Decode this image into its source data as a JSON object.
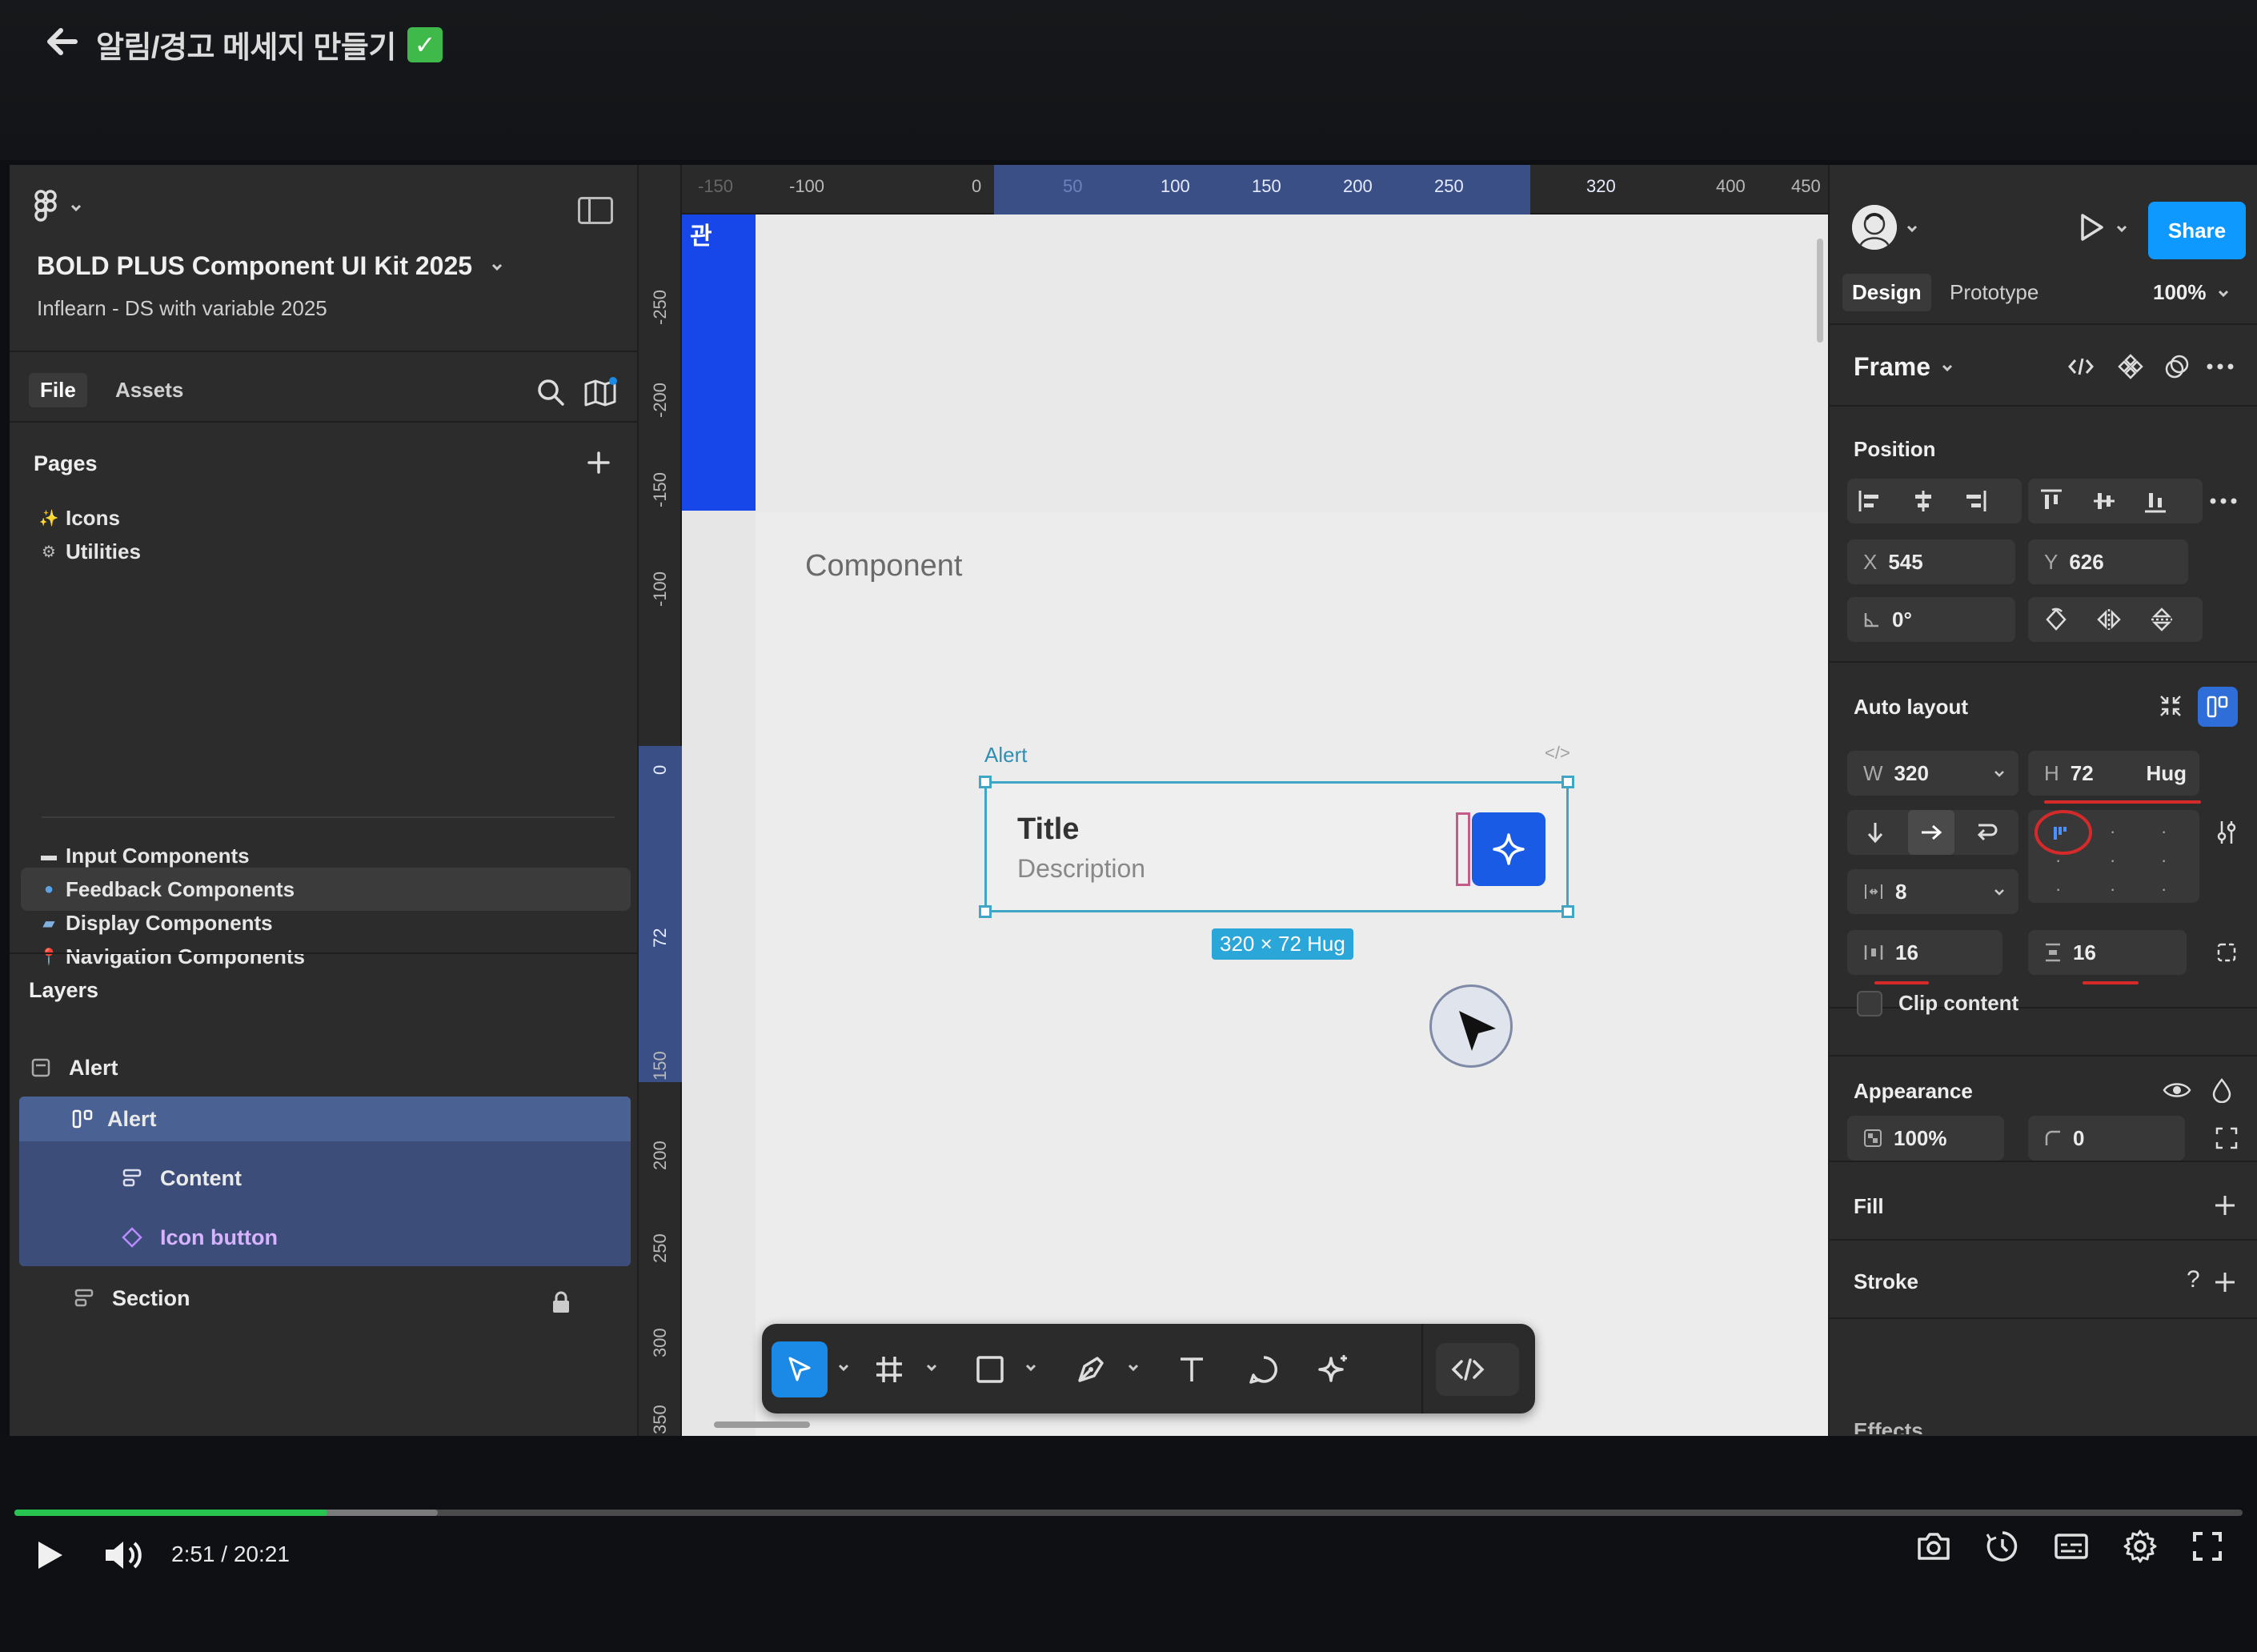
{
  "video": {
    "title": "알림/경고 메세지 만들기",
    "title_badge": "✓",
    "time": "2:51 / 20:21",
    "progress_fraction": 0.1405,
    "buffer_fraction": 0.19
  },
  "left_panel": {
    "file_name": "BOLD PLUS Component UI Kit 2025",
    "file_subtitle": "Inflearn - DS with variable 2025",
    "tabs": {
      "file": "File",
      "assets": "Assets"
    },
    "pages_title": "Pages",
    "pages": [
      {
        "emoji": "✨",
        "label": "Icons"
      },
      {
        "emoji": "⚙",
        "label": "Utilities"
      },
      {
        "emoji": "▬",
        "label": "Input Components"
      },
      {
        "emoji": "●",
        "label": "Feedback Components"
      },
      {
        "emoji": "▰",
        "label": "Display Components"
      },
      {
        "emoji": "📍",
        "label": "Navigation Components"
      }
    ],
    "layers_title": "Layers",
    "layers": [
      {
        "label": "Alert"
      },
      {
        "label": "Alert"
      },
      {
        "label": "Content"
      },
      {
        "label": "Icon button"
      },
      {
        "label": "Section"
      }
    ]
  },
  "rulers": {
    "top": [
      "-150",
      "-100",
      "0",
      "50",
      "100",
      "150",
      "200",
      "250",
      "320",
      "400",
      "450"
    ],
    "left": [
      "-250",
      "-200",
      "-150",
      "-100",
      "0",
      "72",
      "150",
      "200",
      "250",
      "300",
      "350"
    ]
  },
  "canvas": {
    "blue_block_glyph": "관",
    "section_label": "Component",
    "frame_label": "Alert",
    "code_icon_glyph": "</>",
    "alert_title": "Title",
    "alert_description": "Description",
    "size_badge": "320 × 72 Hug"
  },
  "right_panel": {
    "share": "Share",
    "tab_design": "Design",
    "tab_prototype": "Prototype",
    "zoom": "100%",
    "frame_type": "Frame",
    "position_title": "Position",
    "x_label": "X",
    "x_value": "545",
    "y_label": "Y",
    "y_value": "626",
    "rotation": "0°",
    "auto_layout_title": "Auto layout",
    "w_label": "W",
    "w_value": "320",
    "h_label": "H",
    "h_value": "72",
    "h_mode": "Hug",
    "gap": "8",
    "padding_h": "16",
    "padding_v": "16",
    "clip_content": "Clip content",
    "appearance_title": "Appearance",
    "opacity": "100%",
    "corner_radius": "0",
    "fill_title": "Fill",
    "stroke_title": "Stroke",
    "stroke_help": "?",
    "effects_title": "Effects"
  },
  "colors": {
    "accent": "#0d99ff",
    "selection": "#3b4d78",
    "canvas_selection": "#3fa6c6",
    "icon_button": "#1a5be6",
    "progress": "#27c452",
    "annotation_red": "#d62a2a"
  }
}
